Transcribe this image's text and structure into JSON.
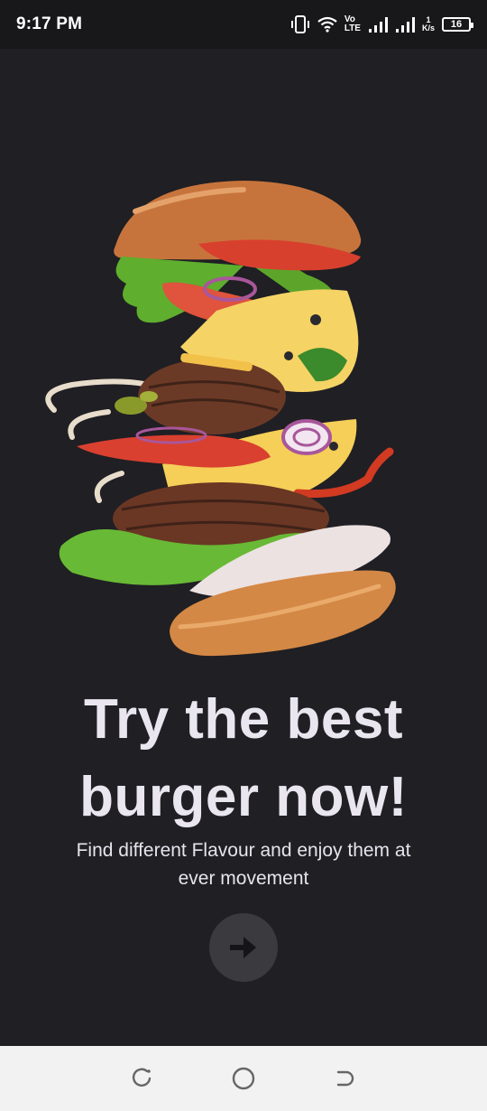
{
  "status_bar": {
    "time": "9:17 PM",
    "lte_top": "Vo",
    "lte_bottom": "LTE",
    "speed_value": "1",
    "speed_unit": "K/s",
    "battery": "16"
  },
  "onboarding": {
    "headline": "Try the best burger now!",
    "subtitle": "Find different Flavour and enjoy them at ever movement",
    "next_icon": "arrow-right-icon"
  },
  "nav_bar": {
    "back_icon": "recent-apps-icon",
    "home_icon": "home-icon",
    "recents_icon": "back-icon"
  },
  "colors": {
    "background": "#1f1f24",
    "text": "#e9e6ef",
    "button": "#3a3a3f",
    "nav_bar": "#f2f2f2"
  }
}
